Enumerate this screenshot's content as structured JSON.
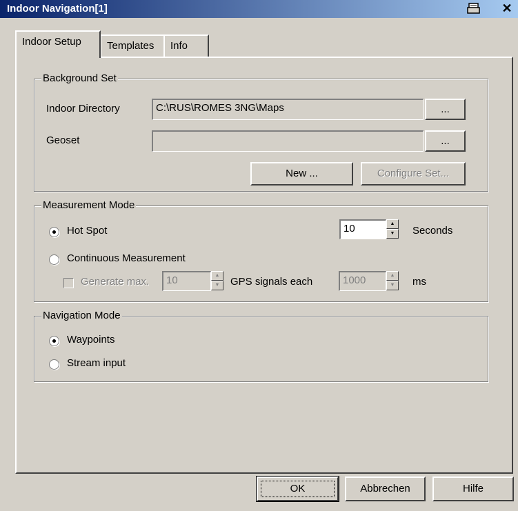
{
  "window": {
    "title": "Indoor Navigation[1]"
  },
  "tabs": [
    {
      "label": "Indoor Setup"
    },
    {
      "label": "Templates"
    },
    {
      "label": "Info"
    }
  ],
  "background_set": {
    "title": "Background Set",
    "indoor_directory_label": "Indoor Directory",
    "indoor_directory_value": "C:\\RUS\\ROMES 3NG\\Maps",
    "geoset_label": "Geoset",
    "geoset_value": "",
    "browse_label": "...",
    "new_label": "New ...",
    "configure_label": "Configure Set..."
  },
  "measurement_mode": {
    "title": "Measurement Mode",
    "hot_spot_label": "Hot Spot",
    "hot_spot_value": "10",
    "seconds_label": "Seconds",
    "continuous_label": "Continuous Measurement",
    "generate_label": "Generate max.",
    "generate_value": "10",
    "gps_label": "GPS signals each",
    "gps_value": "1000",
    "ms_label": "ms"
  },
  "navigation_mode": {
    "title": "Navigation Mode",
    "waypoints_label": "Waypoints",
    "stream_label": "Stream input"
  },
  "footer": {
    "ok_label": "OK",
    "cancel_label": "Abbrechen",
    "help_label": "Hilfe"
  }
}
